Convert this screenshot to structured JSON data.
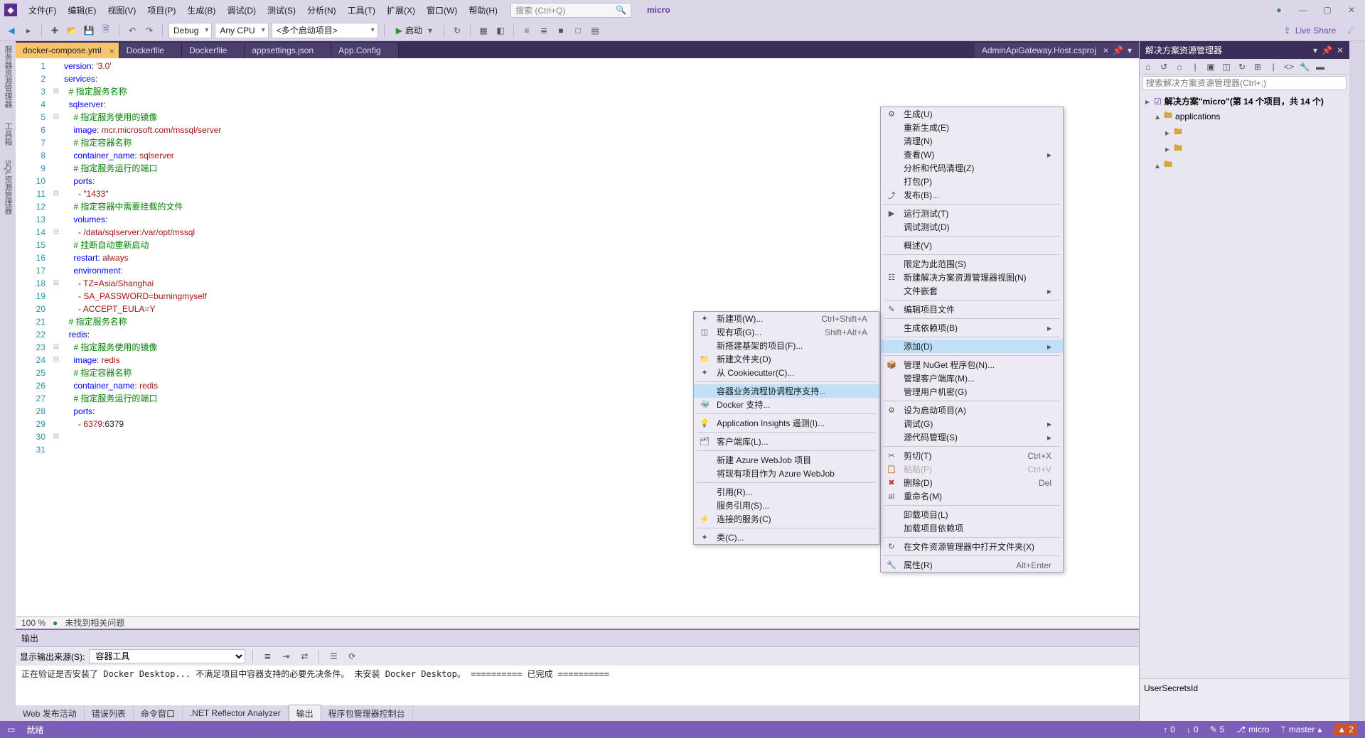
{
  "menubar": {
    "items": [
      "文件(F)",
      "编辑(E)",
      "视图(V)",
      "项目(P)",
      "生成(B)",
      "调试(D)",
      "测试(S)",
      "分析(N)",
      "工具(T)",
      "扩展(X)",
      "窗口(W)",
      "帮助(H)"
    ],
    "search_placeholder": "搜索 (Ctrl+Q)",
    "ext_label": "micro"
  },
  "toolbar": {
    "config": "Debug",
    "platform": "Any CPU",
    "startup": "<多个启动项目>",
    "start_label": "启动",
    "live_share": "Live Share"
  },
  "tabs": {
    "items": [
      {
        "label": "docker-compose.yml",
        "active": true,
        "closable": true
      },
      {
        "label": "Dockerfile"
      },
      {
        "label": "Dockerfile"
      },
      {
        "label": "appsettings.json"
      },
      {
        "label": "App.Config"
      }
    ],
    "right": {
      "label": "AdminApiGateway.Host.csproj"
    }
  },
  "code": {
    "lines": [
      {
        "n": 1,
        "f": "",
        "h": "<span class='kw'>version</span><span class='plain'>: </span><span class='str'>'3.0'</span>"
      },
      {
        "n": 2,
        "f": "",
        "h": ""
      },
      {
        "n": 3,
        "f": "⊟",
        "h": "<span class='kw'>services</span><span class='plain'>:</span>"
      },
      {
        "n": 4,
        "f": "",
        "h": "  <span class='cmt'># 指定服务名称</span>"
      },
      {
        "n": 5,
        "f": "⊟",
        "h": "  <span class='kw'>sqlserver</span><span class='plain'>:</span>"
      },
      {
        "n": 6,
        "f": "",
        "h": "    <span class='cmt'># 指定服务使用的镜像</span>"
      },
      {
        "n": 7,
        "f": "",
        "h": "    <span class='kw'>image</span><span class='plain'>: </span><span class='str'>mcr.microsoft.com/mssql/server</span>"
      },
      {
        "n": 8,
        "f": "",
        "h": "    <span class='cmt'># 指定容器名称</span>"
      },
      {
        "n": 9,
        "f": "",
        "h": "    <span class='kw'>container_name</span><span class='plain'>: </span><span class='str'>sqlserver</span>"
      },
      {
        "n": 10,
        "f": "",
        "h": "    <span class='cmt'># 指定服务运行的端口</span>"
      },
      {
        "n": 11,
        "f": "⊟",
        "h": "    <span class='kw'>ports</span><span class='plain'>:</span>"
      },
      {
        "n": 12,
        "f": "",
        "h": "      <span class='plain'>- </span><span class='str'>\"1433\"</span>"
      },
      {
        "n": 13,
        "f": "",
        "h": "    <span class='cmt'># 指定容器中需要挂载的文件</span>"
      },
      {
        "n": 14,
        "f": "⊟",
        "h": "    <span class='kw'>volumes</span><span class='plain'>:</span>"
      },
      {
        "n": 15,
        "f": "",
        "h": "      <span class='plain'>- </span><span class='str'>/data/sqlserver:/var/opt/mssql</span>"
      },
      {
        "n": 16,
        "f": "",
        "h": "    <span class='cmt'># 挂断自动重新启动</span>"
      },
      {
        "n": 17,
        "f": "",
        "h": "    <span class='kw'>restart</span><span class='plain'>: </span><span class='str'>always</span>"
      },
      {
        "n": 18,
        "f": "⊟",
        "h": "    <span class='kw'>environment</span><span class='plain'>:</span>"
      },
      {
        "n": 19,
        "f": "",
        "h": "      <span class='plain'>- </span><span class='str'>TZ=Asia/Shanghai</span>"
      },
      {
        "n": 20,
        "f": "",
        "h": "      <span class='plain'>- </span><span class='str'>SA_PASSWORD=burningmyself</span>"
      },
      {
        "n": 21,
        "f": "",
        "h": "      <span class='plain'>- </span><span class='str'>ACCEPT_EULA=Y</span>"
      },
      {
        "n": 22,
        "f": "",
        "h": ""
      },
      {
        "n": 23,
        "f": "⊟",
        "h": "  <span class='cmt'># 指定服务名称</span>"
      },
      {
        "n": 24,
        "f": "⊟",
        "h": "  <span class='kw'>redis</span><span class='plain'>:</span>"
      },
      {
        "n": 25,
        "f": "",
        "h": "    <span class='cmt'># 指定服务使用的镜像</span>"
      },
      {
        "n": 26,
        "f": "",
        "h": "    <span class='kw'>image</span><span class='plain'>: </span><span class='str'>redis</span>"
      },
      {
        "n": 27,
        "f": "",
        "h": "    <span class='cmt'># 指定容器名称</span>"
      },
      {
        "n": 28,
        "f": "",
        "h": "    <span class='kw'>container_name</span><span class='plain'>: </span><span class='str'>redis</span>"
      },
      {
        "n": 29,
        "f": "",
        "h": "    <span class='cmt'># 指定服务运行的端口</span>"
      },
      {
        "n": 30,
        "f": "⊟",
        "h": "    <span class='kw'>ports</span><span class='plain'>:</span>"
      },
      {
        "n": 31,
        "f": "",
        "h": "      <span class='plain'>- </span><span class='str'>6379</span><span class='plain'>:6379</span>"
      }
    ],
    "no_issues": "未找到相关问题",
    "zoom": "100 %"
  },
  "output": {
    "title": "输出",
    "source_label": "显示输出来源(S):",
    "source_value": "容器工具",
    "body": "正在验证是否安装了 Docker Desktop...\n不满足项目中容器支持的必要先决条件。\n未安装 Docker Desktop。\n========== 已完成 ==========",
    "tabs": [
      "Web 发布活动",
      "错误列表",
      "命令窗口",
      ".NET Reflector Analyzer",
      "输出",
      "程序包管理器控制台"
    ],
    "active_tab": 4
  },
  "solution": {
    "title": "解决方案资源管理器",
    "search_placeholder": "搜索解决方案资源管理器(Ctrl+;)",
    "sln": "解决方案\"micro\"(第 14 个项目，共 14 个)",
    "folder": "applications"
  },
  "properties": {
    "label": "UserSecretsId"
  },
  "ctx_main": {
    "groups": [
      [
        {
          "ic": "⚙",
          "lbl": "生成(U)"
        },
        {
          "lbl": "重新生成(E)"
        },
        {
          "lbl": "清理(N)"
        },
        {
          "lbl": "查看(W)",
          "sub": true
        },
        {
          "lbl": "分析和代码清理(Z)"
        },
        {
          "lbl": "打包(P)"
        },
        {
          "ic": "⤴",
          "lbl": "发布(B)..."
        }
      ],
      [
        {
          "ic": "▶",
          "lbl": "运行测试(T)"
        },
        {
          "lbl": "调试测试(D)"
        }
      ],
      [
        {
          "lbl": "概述(V)"
        }
      ],
      [
        {
          "lbl": "限定为此范围(S)"
        },
        {
          "ic": "☷",
          "lbl": "新建解决方案资源管理器视图(N)"
        },
        {
          "lbl": "文件嵌套",
          "sub": true
        }
      ],
      [
        {
          "ic": "✎",
          "lbl": "编辑项目文件"
        }
      ],
      [
        {
          "lbl": "生成依赖项(B)",
          "sub": true
        }
      ],
      [
        {
          "lbl": "添加(D)",
          "sub": true,
          "hl": true
        }
      ],
      [
        {
          "ic": "📦",
          "lbl": "管理 NuGet 程序包(N)..."
        },
        {
          "lbl": "管理客户端库(M)..."
        },
        {
          "lbl": "管理用户机密(G)"
        }
      ],
      [
        {
          "ic": "⚙",
          "lbl": "设为启动项目(A)"
        },
        {
          "lbl": "调试(G)",
          "sub": true
        },
        {
          "lbl": "源代码管理(S)",
          "sub": true
        }
      ],
      [
        {
          "ic": "✂",
          "lbl": "剪切(T)",
          "sc": "Ctrl+X"
        },
        {
          "ic": "📋",
          "lbl": "粘贴(P)",
          "sc": "Ctrl+V",
          "dis": true
        },
        {
          "ic": "✖",
          "lbl": "删除(D)",
          "sc": "Del",
          "red": true
        },
        {
          "ic": "aI",
          "lbl": "重命名(M)"
        }
      ],
      [
        {
          "lbl": "卸载项目(L)"
        },
        {
          "lbl": "加载项目依赖项"
        }
      ],
      [
        {
          "ic": "↻",
          "lbl": "在文件资源管理器中打开文件夹(X)"
        }
      ],
      [
        {
          "ic": "🔧",
          "lbl": "属性(R)",
          "sc": "Alt+Enter"
        }
      ]
    ]
  },
  "ctx_sub": {
    "groups": [
      [
        {
          "ic": "✦",
          "lbl": "新建项(W)...",
          "sc": "Ctrl+Shift+A"
        },
        {
          "ic": "◫",
          "lbl": "现有项(G)...",
          "sc": "Shift+Alt+A"
        },
        {
          "lbl": "新搭建基架的项目(F)..."
        },
        {
          "ic": "📁",
          "lbl": "新建文件夹(D)"
        },
        {
          "ic": "✦",
          "lbl": "从 Cookiecutter(C)..."
        }
      ],
      [
        {
          "lbl": "容器业务流程协调程序支持...",
          "hl": true
        },
        {
          "ic": "🐳",
          "lbl": "Docker 支持..."
        }
      ],
      [
        {
          "ic": "💡",
          "lbl": "Application Insights 遥测(I)..."
        }
      ],
      [
        {
          "ic": "🗂",
          "lbl": "客户端库(L)..."
        }
      ],
      [
        {
          "lbl": "新建 Azure WebJob 项目"
        },
        {
          "lbl": "将现有项目作为 Azure WebJob"
        }
      ],
      [
        {
          "lbl": "引用(R)..."
        },
        {
          "lbl": "服务引用(S)..."
        },
        {
          "ic": "⚡",
          "lbl": "连接的服务(C)"
        }
      ],
      [
        {
          "ic": "✦",
          "lbl": "类(C)..."
        }
      ]
    ]
  },
  "statusbar": {
    "ready": "就绪",
    "up": "0",
    "down": "0",
    "pen": "5",
    "repo": "micro",
    "branch": "master",
    "errs": "2"
  }
}
